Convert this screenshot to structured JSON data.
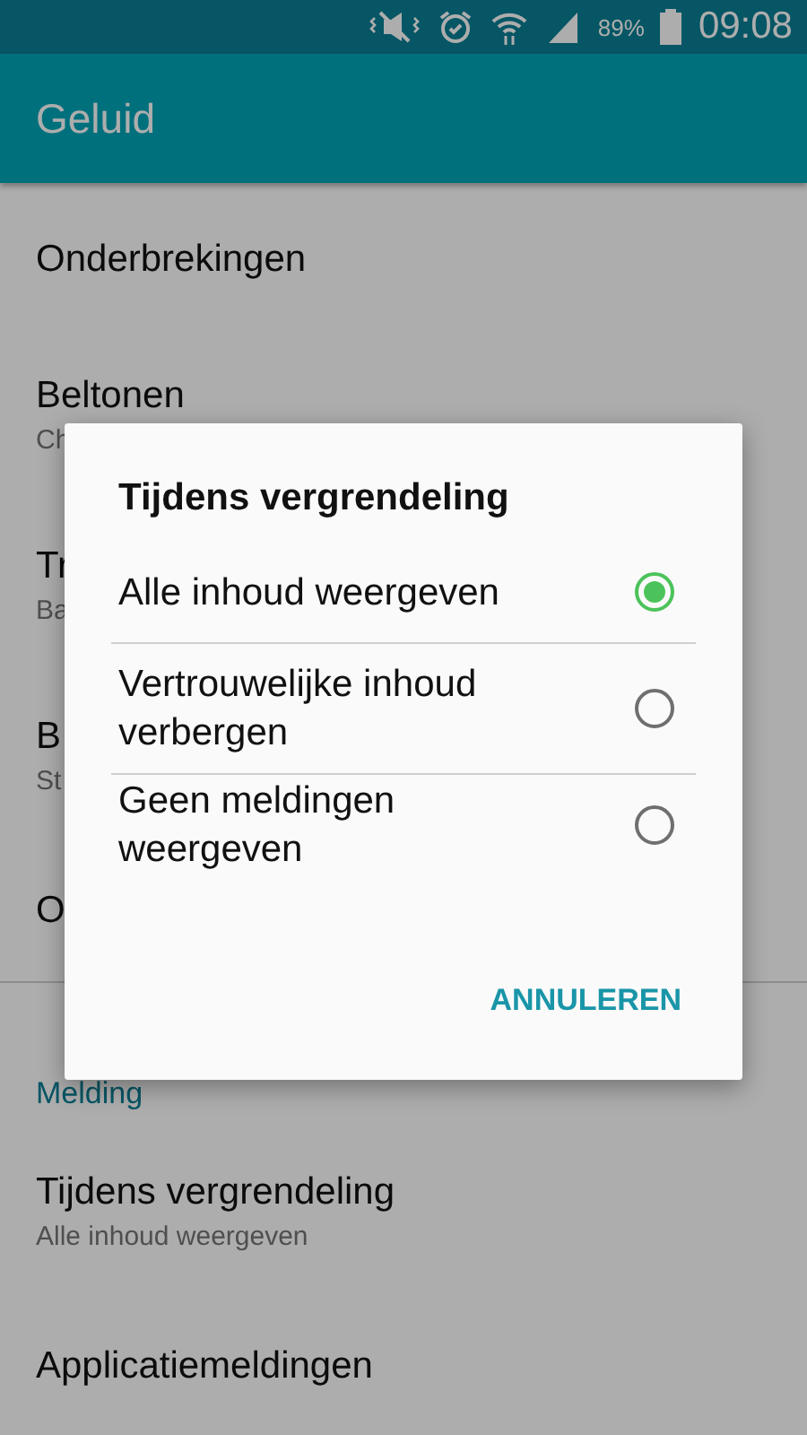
{
  "status_bar": {
    "battery_text": "89%",
    "time": "09:08"
  },
  "app_bar": {
    "title": "Geluid"
  },
  "sections": [
    {
      "items": [
        {
          "title": "Onderbrekingen"
        },
        {
          "title": "Beltonen",
          "subtitle": "Ch"
        },
        {
          "title": "Tr",
          "subtitle": "Ba"
        },
        {
          "title": "B",
          "subtitle": "St"
        },
        {
          "title": "O"
        }
      ]
    },
    {
      "header": "Melding",
      "items": [
        {
          "title": "Tijdens vergrendeling",
          "subtitle": "Alle inhoud weergeven"
        },
        {
          "title": "Applicatiemeldingen"
        }
      ]
    }
  ],
  "dialog": {
    "title": "Tijdens vergrendeling",
    "options": [
      {
        "label": "Alle inhoud weergeven",
        "selected": true
      },
      {
        "label": "Vertrouwelijke inhoud verbergen",
        "selected": false
      },
      {
        "label": "Geen meldingen weergeven",
        "selected": false
      }
    ],
    "buttons": [
      "ANNULEREN"
    ]
  }
}
